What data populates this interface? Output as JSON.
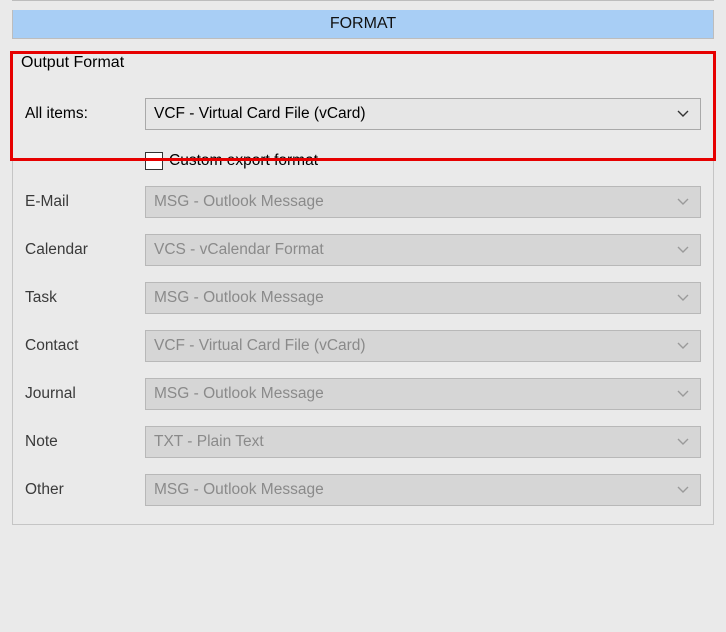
{
  "header": {
    "title": "FORMAT"
  },
  "group": {
    "title": "Output Format"
  },
  "allItems": {
    "label": "All items:",
    "value": "VCF - Virtual Card File (vCard)"
  },
  "customExport": {
    "label": "Custom export format",
    "checked": false
  },
  "rows": [
    {
      "label": "E-Mail",
      "value": "MSG - Outlook Message"
    },
    {
      "label": "Calendar",
      "value": "VCS - vCalendar Format"
    },
    {
      "label": "Task",
      "value": "MSG - Outlook Message"
    },
    {
      "label": "Contact",
      "value": "VCF - Virtual Card File (vCard)"
    },
    {
      "label": "Journal",
      "value": "MSG - Outlook Message"
    },
    {
      "label": "Note",
      "value": "TXT - Plain Text"
    },
    {
      "label": "Other",
      "value": "MSG - Outlook Message"
    }
  ],
  "colors": {
    "headerBg": "#a8cef5",
    "highlight": "#e60000"
  }
}
